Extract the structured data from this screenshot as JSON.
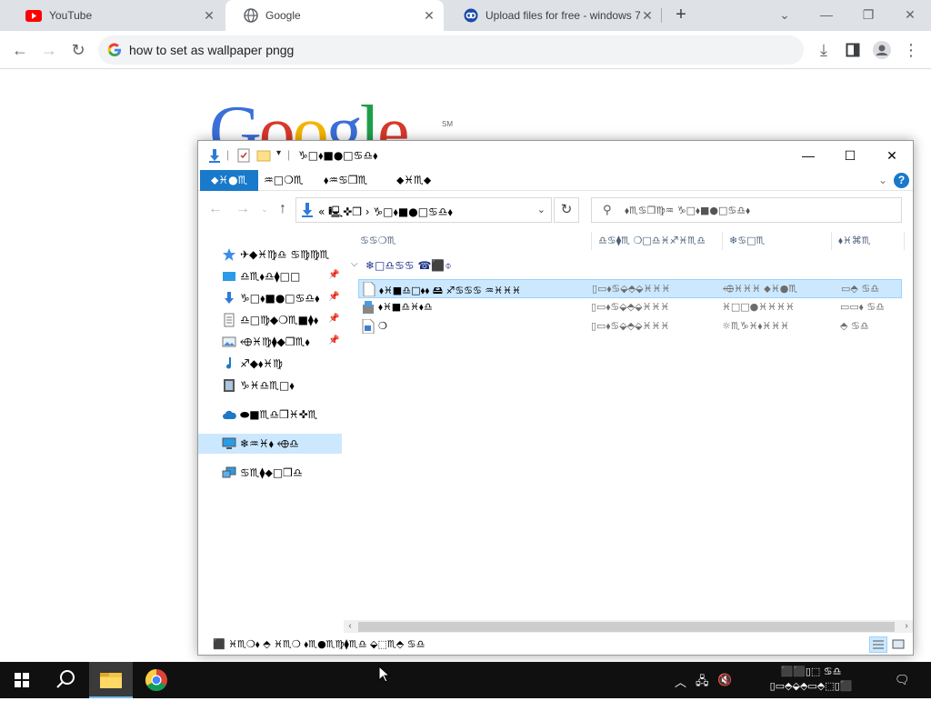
{
  "browser": {
    "tabs": [
      {
        "title": "YouTube",
        "icon": "youtube-icon",
        "active": false
      },
      {
        "title": "Google",
        "icon": "google-globe-icon",
        "active": true
      },
      {
        "title": "Upload files for free - windows 7",
        "icon": "upload-site-icon",
        "active": false
      }
    ],
    "new_tab_label": "+",
    "omnibox_text": "how to set as wallpaper pngg",
    "page": {
      "logo_letters": [
        "G",
        "o",
        "o",
        "g",
        "l",
        "e"
      ],
      "logo_colors": [
        "#3b6fd8",
        "#d6392c",
        "#f4b400",
        "#3b6fd8",
        "#1f9e4a",
        "#d6392c"
      ],
      "logo_sm": "SM"
    }
  },
  "explorer": {
    "title": "♑□⬧■●□♋♎⬧",
    "ribbon_tabs": [
      "⬥♓●♏",
      "♒□❍♏",
      "⬧♒♋❒♏",
      "⬥♓♏⬥"
    ],
    "address_text": "« 🖳✜❒  ›  ♑□⬧■●□♋♎⬧",
    "search_placeholder": "⬧♏♋❒♍♒  ♑□⬧■●□♋♎⬧",
    "nav_items": [
      {
        "label": "✈◆♓♍♎  ♋♍♍♏",
        "icon": "quick-access-star-icon",
        "pinned": false
      },
      {
        "label": "♎♏⬧♎⧫□□",
        "icon": "desktop-icon",
        "pinned": true
      },
      {
        "label": "♑□⬧■●□♋♎⬧",
        "icon": "downloads-arrow-icon",
        "pinned": true
      },
      {
        "label": "♎□♍◆❍♏■⧫⬧",
        "icon": "documents-icon",
        "pinned": true
      },
      {
        "label": "⬲♓♍⧫◆❒♏⬧",
        "icon": "pictures-icon",
        "pinned": true
      },
      {
        "label": "♐◆⬧♓♍",
        "icon": "music-note-icon",
        "pinned": false
      },
      {
        "label": "♑♓♎♏□⬧",
        "icon": "videos-icon",
        "pinned": false
      },
      {
        "label": "⬬■♏♎❒♓✜♏",
        "icon": "onedrive-cloud-icon",
        "pinned": false
      },
      {
        "label": "❄♒♓⬧  ⬲♎",
        "icon": "this-pc-icon",
        "pinned": false
      },
      {
        "label": "♋♏⧫⬥□❒♎",
        "icon": "network-icon",
        "pinned": false
      }
    ],
    "columns": [
      "♋♋❍♏",
      "♎♋⧫♏  ❍□♎♓♐♓♏♎",
      "❄♋□♏",
      "⬧♓⌘♏"
    ],
    "group_label": "❄□♎♋♋ ☎⬛⌽",
    "rows": [
      {
        "name": "⬧♓■♎□⬧⬧  🖴  ♐♋♋♋  ♒♓♓♓",
        "date": "▯▭⬧♋⬙⬘⬙♓♓♓",
        "type": "⬲♓♓♓  ⬥♓●♏",
        "size": "▭⬘  ♋♎",
        "icon": "file-icon",
        "selected": true
      },
      {
        "name": "⬧♓■♎♓⬧♎",
        "date": "▯▭⬧♋⬙⬘⬙♓♓♓",
        "type": "♓□□●♓♓♓♓",
        "size": "▭▭⬧  ♋♎",
        "icon": "installer-icon",
        "selected": false
      },
      {
        "name": "❍",
        "date": "▯▭⬧♋⬙⬘⬙♓♓♓",
        "type": "☼♏♑♓⬧♓♓♓",
        "size": "⬘  ♋♎",
        "icon": "registry-file-icon",
        "selected": false
      }
    ],
    "status_text": "⬛  ♓♏❍⬧    ⬘  ♓♏❍  ⬧♏●♏♍⧫♏♎    ⬙⬚♏⬘  ♋♎"
  },
  "taskbar": {
    "clock_time": "⬛⬛▯⬚  ♋♎",
    "clock_date": "▯▭⬘⬙⬘▭⬘⬚▯⬛"
  }
}
